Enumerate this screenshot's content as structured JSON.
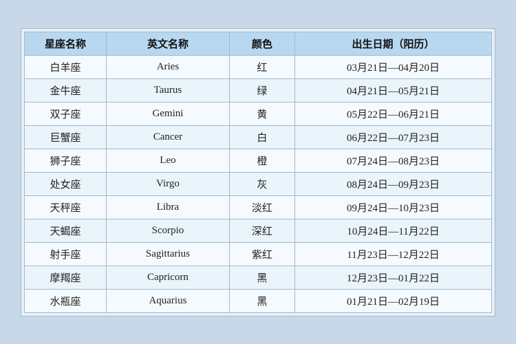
{
  "table": {
    "headers": {
      "zh_name": "星座名称",
      "en_name": "英文名称",
      "color": "颜色",
      "date": "出生日期（阳历）"
    },
    "rows": [
      {
        "zh": "白羊座",
        "en": "Aries",
        "color": "红",
        "date": "03月21日—04月20日"
      },
      {
        "zh": "金牛座",
        "en": "Taurus",
        "color": "绿",
        "date": "04月21日—05月21日"
      },
      {
        "zh": "双子座",
        "en": "Gemini",
        "color": "黄",
        "date": "05月22日—06月21日"
      },
      {
        "zh": "巨蟹座",
        "en": "Cancer",
        "color": "白",
        "date": "06月22日—07月23日"
      },
      {
        "zh": "狮子座",
        "en": "Leo",
        "color": "橙",
        "date": "07月24日—08月23日"
      },
      {
        "zh": "处女座",
        "en": "Virgo",
        "color": "灰",
        "date": "08月24日—09月23日"
      },
      {
        "zh": "天秤座",
        "en": "Libra",
        "color": "淡红",
        "date": "09月24日—10月23日"
      },
      {
        "zh": "天蝎座",
        "en": "Scorpio",
        "color": "深红",
        "date": "10月24日—11月22日"
      },
      {
        "zh": "射手座",
        "en": "Sagittarius",
        "color": "紫红",
        "date": "11月23日—12月22日"
      },
      {
        "zh": "摩羯座",
        "en": "Capricorn",
        "color": "黑",
        "date": "12月23日—01月22日"
      },
      {
        "zh": "水瓶座",
        "en": "Aquarius",
        "color": "黑",
        "date": "01月21日—02月19日"
      }
    ]
  }
}
